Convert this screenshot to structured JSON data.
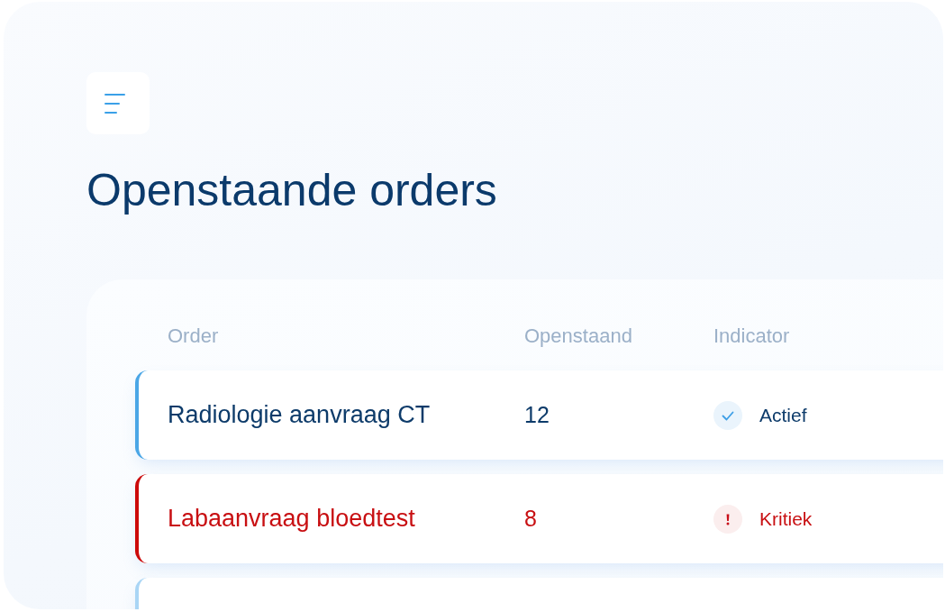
{
  "title": "Openstaande orders",
  "table": {
    "columns": [
      "Order",
      "Openstaand",
      "Indicator"
    ],
    "rows": [
      {
        "order": "Radiologie aanvraag CT",
        "open": "12",
        "indicator": {
          "kind": "ok",
          "label": "Actief"
        },
        "color": "#4aa6e6"
      },
      {
        "order": "Labaanvraag bloedtest",
        "open": "8",
        "indicator": {
          "kind": "critical",
          "label": "Kritiek"
        },
        "color": "#cc0a0a"
      },
      {
        "color": "#a9d5f5"
      }
    ]
  }
}
